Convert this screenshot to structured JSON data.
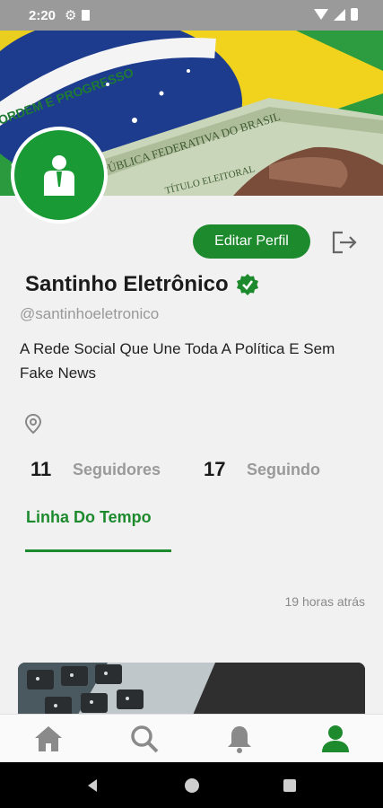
{
  "status_bar": {
    "time": "2:20"
  },
  "profile": {
    "name": "Santinho Eletrônico",
    "handle": "@santinhoeletronico",
    "bio": "A Rede Social Que Une Toda A Política E Sem Fake News",
    "edit_button": "Editar Perfil",
    "followers_count": "11",
    "followers_label": "Seguidores",
    "following_count": "17",
    "following_label": "Seguindo",
    "verified": true
  },
  "cover": {
    "flag_text": "ORDEM E PROGRESSO",
    "card_text_1": "PÚBLICA FEDERATIVA DO BRASIL",
    "card_text_2": "TÍTULO ELEITORAL"
  },
  "tabs": [
    {
      "label": "Linha Do Tempo",
      "active": true
    }
  ],
  "post": {
    "time_ago": "19 horas atrás"
  },
  "bottom_nav": [
    {
      "icon": "home-icon"
    },
    {
      "icon": "search-icon"
    },
    {
      "icon": "bell-icon"
    },
    {
      "icon": "person-icon",
      "active": true
    }
  ],
  "colors": {
    "accent": "#1e8a2e",
    "active_nav": "#1e8a2e",
    "inactive_nav": "#8a8a8a"
  }
}
